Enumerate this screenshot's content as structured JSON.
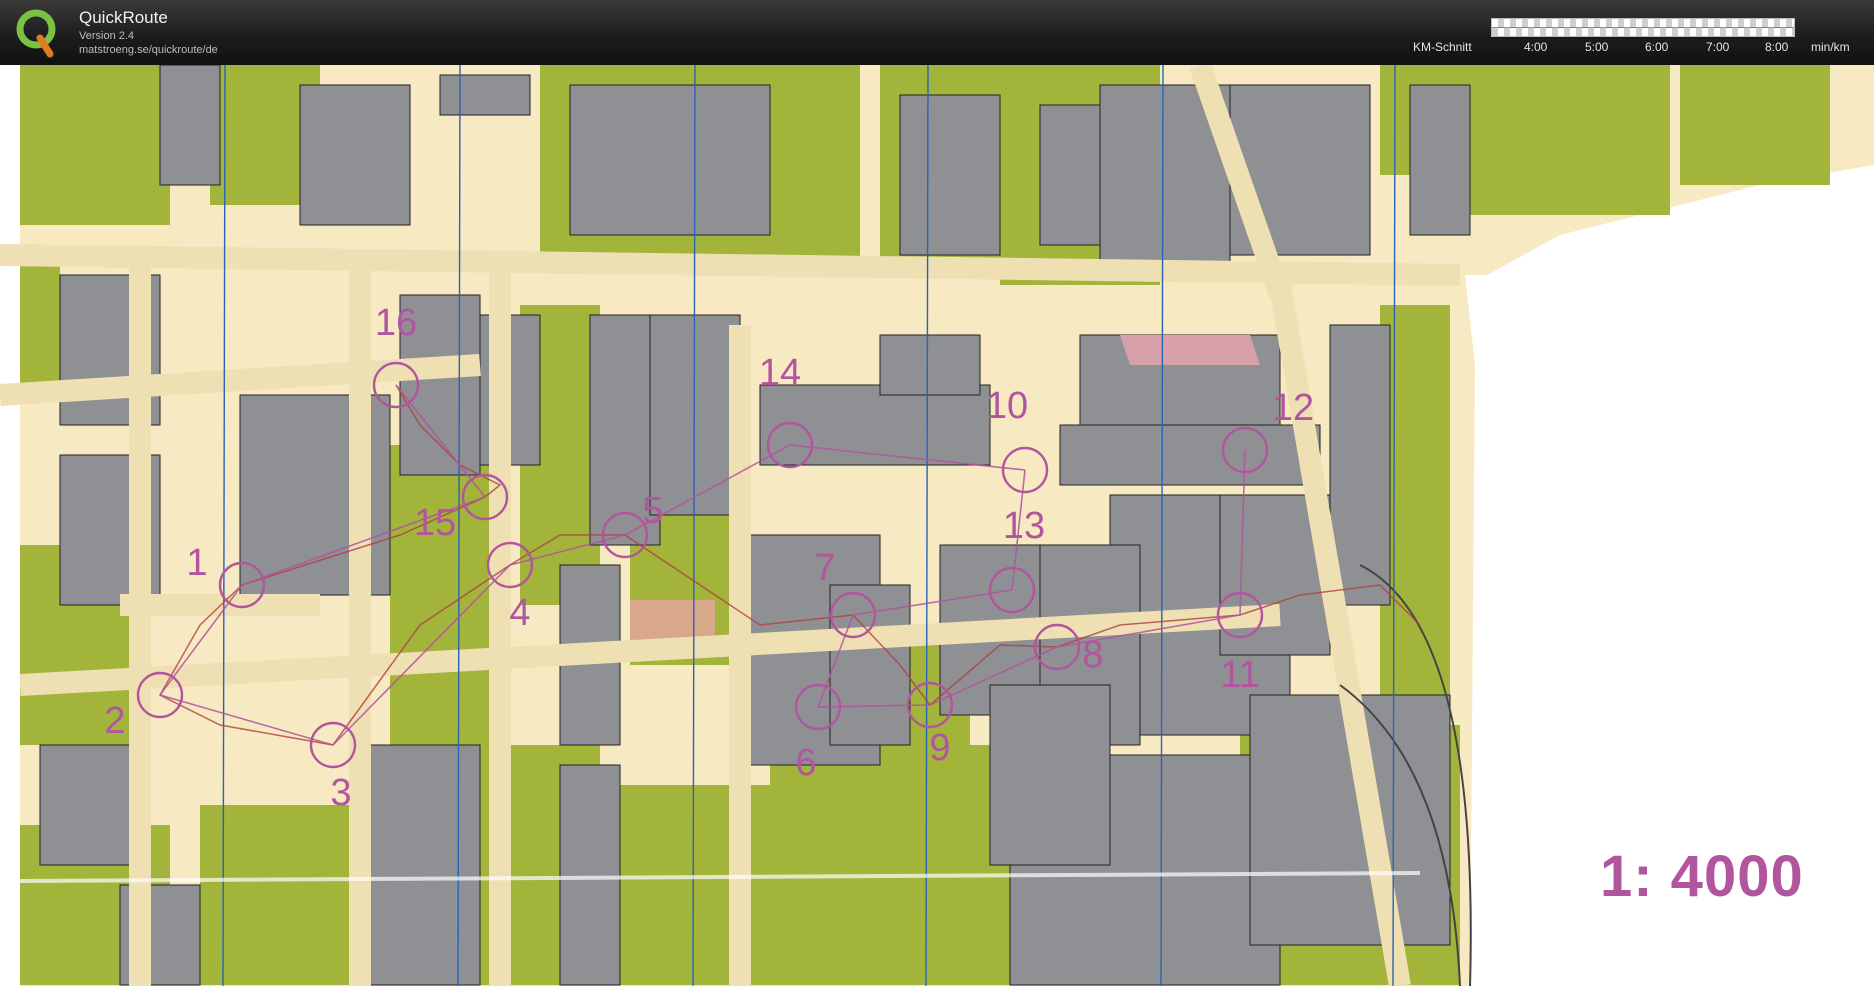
{
  "header": {
    "app_name": "QuickRoute",
    "version": "Version 2.4",
    "url": "matstroeng.se/quickroute/de",
    "logo_letter": "Q"
  },
  "legend": {
    "label": "KM-Schnitt",
    "ticks": [
      "4:00",
      "5:00",
      "6:00",
      "7:00",
      "8:00"
    ],
    "unit": "min/km"
  },
  "map": {
    "scale_text": "1: 4000",
    "course_color": "#b1559e",
    "route_color": "#b04040",
    "controls": [
      {
        "label": "1"
      },
      {
        "label": "2"
      },
      {
        "label": "3"
      },
      {
        "label": "4"
      },
      {
        "label": "5"
      },
      {
        "label": "6"
      },
      {
        "label": "7"
      },
      {
        "label": "8"
      },
      {
        "label": "9"
      },
      {
        "label": "10"
      },
      {
        "label": "11"
      },
      {
        "label": "12"
      },
      {
        "label": "13"
      },
      {
        "label": "14"
      },
      {
        "label": "15"
      },
      {
        "label": "16"
      }
    ]
  }
}
